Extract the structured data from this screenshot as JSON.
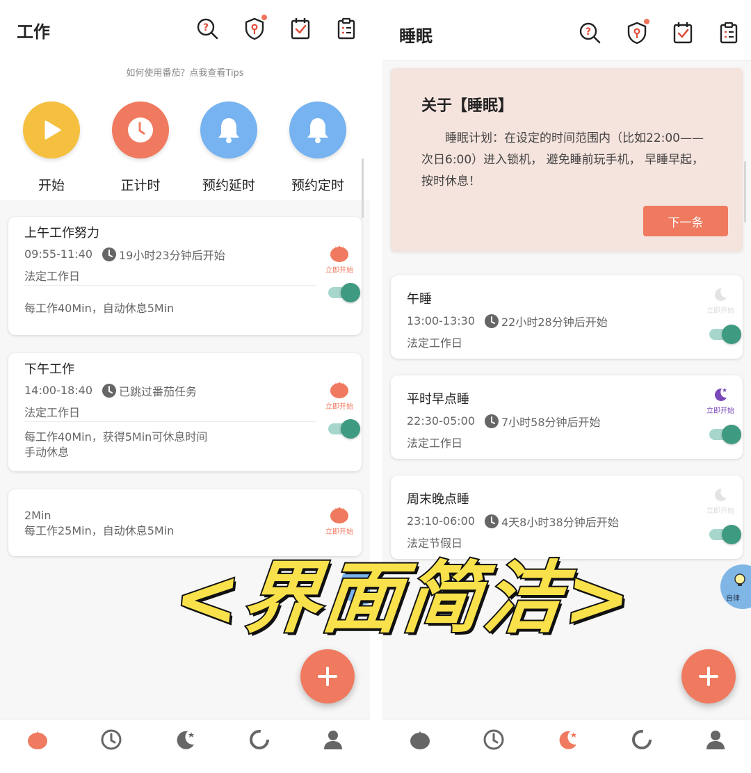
{
  "left": {
    "title": "工作",
    "tips": "如何使用番茄？点我查看Tips",
    "actions": [
      {
        "label": "开始",
        "icon": "play-icon",
        "color": "#f5c040"
      },
      {
        "label": "正计时",
        "icon": "clock-icon",
        "color": "#f07a5f"
      },
      {
        "label": "预约延时",
        "icon": "bell-icon",
        "color": "#76b3f0"
      },
      {
        "label": "预约定时",
        "icon": "bell-icon",
        "color": "#76b3f0"
      }
    ],
    "cards": [
      {
        "name": "上午工作努力",
        "time": "09:55-11:40",
        "status": "19小时23分钟后开始",
        "sub": "法定工作日",
        "desc": "每工作40Min，自动休息5Min",
        "start_label": "立即开始"
      },
      {
        "name": "下午工作",
        "time": "14:00-18:40",
        "status": "已跳过番茄任务",
        "sub": "法定工作日",
        "desc": "每工作40Min，获得5Min可休息时间",
        "desc2": "手动休息",
        "start_label": "立即开始"
      },
      {
        "name": "",
        "time": "2Min",
        "desc": "每工作25Min，自动休息5Min",
        "start_label": "立即开始"
      }
    ]
  },
  "right": {
    "title": "睡眠",
    "about": {
      "title": "关于【睡眠】",
      "body": "睡眠计划：在设定的时间范围内（比如22:00——次日6:00）进入锁机， 避免睡前玩手机， 早睡早起， 按时休息！",
      "next_label": "下一条"
    },
    "cards": [
      {
        "name": "午睡",
        "time": "13:00-13:30",
        "status": "22小时28分钟后开始",
        "sub": "法定工作日",
        "start_label": "立即开始",
        "active": false
      },
      {
        "name": "平时早点睡",
        "time": "22:30-05:00",
        "status": "7小时58分钟后开始",
        "sub": "法定工作日",
        "start_label": "立即开始",
        "active": true
      },
      {
        "name": "周末晚点睡",
        "time": "23:10-06:00",
        "status": "4天8小时38分钟后开始",
        "sub": "法定节假日",
        "start_label": "立即开始",
        "active": false
      }
    ],
    "floating_label": "自律"
  },
  "overlay_caption": "<界面简洁>",
  "colors": {
    "accent": "#ef7a5f",
    "toggle_on": "#3e9a80",
    "about_bg": "#f5e3dd",
    "purple": "#7a48b8",
    "caption_fill": "#f8e14a"
  },
  "nav_icons": [
    "tomato-icon",
    "clock-icon",
    "moon-icon",
    "ring-icon",
    "person-icon"
  ]
}
